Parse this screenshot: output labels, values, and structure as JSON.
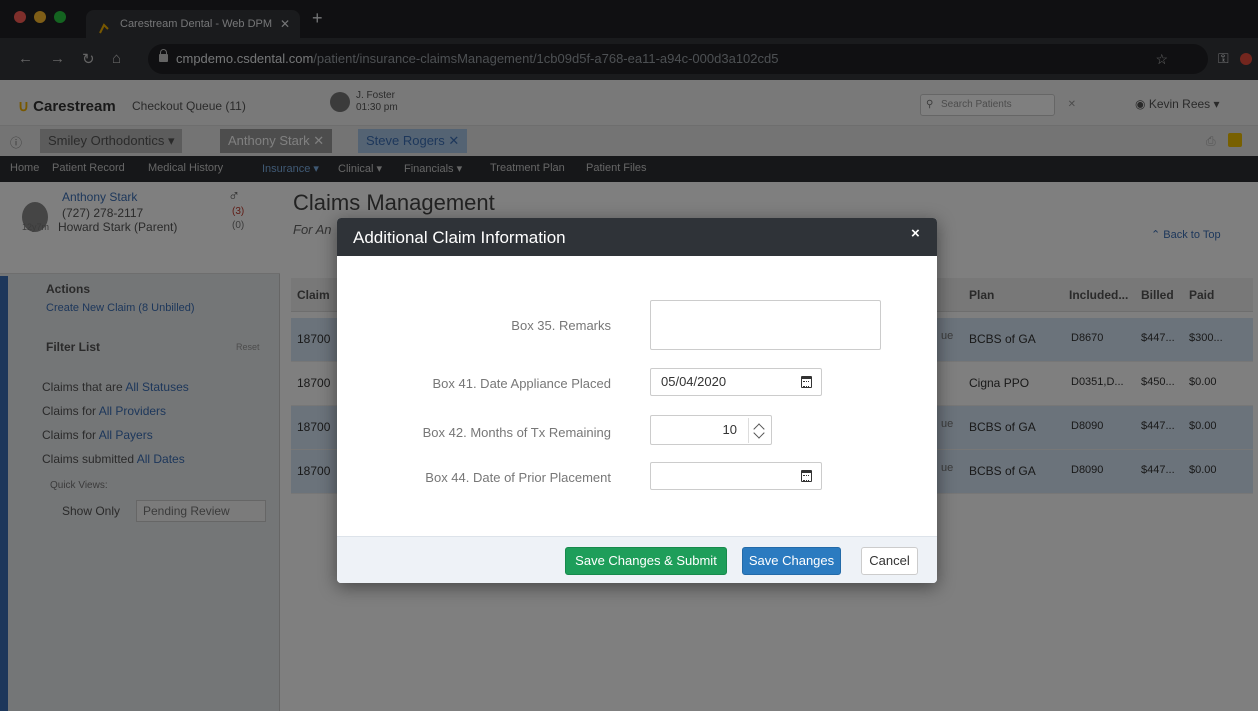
{
  "browser": {
    "tab_title": "Carestream Dental - Web DPM",
    "url_host": "cmpdemo.csdental.com",
    "url_path": "/patient/insurance-claimsManagement/1cb09d5f-a768-ea11-a94c-000d3a102cd5"
  },
  "app_header": {
    "logo": "Carestream",
    "checkout": "Checkout Queue (11)",
    "user_name": "J. Foster",
    "user_time": "01:30 pm",
    "search_placeholder": "Search Patients",
    "account": "Kevin Rees"
  },
  "patient_tabs": [
    "Smiley Orthodontics",
    "Anthony Stark",
    "Steve Rogers"
  ],
  "nav": [
    "Home",
    "Patient Record",
    "Medical History",
    "Insurance",
    "Clinical",
    "Financials",
    "Treatment Plan",
    "Patient Files"
  ],
  "patient": {
    "name": "Anthony Stark",
    "phone": "(727) 278-2117",
    "age": "12y7m",
    "guardian": "Howard Stark (Parent)",
    "count1": "(3)",
    "count2": "(0)"
  },
  "page": {
    "title": "Claims Management",
    "subtitle": "For An",
    "back": "Back to Top"
  },
  "sidebar": {
    "actions": "Actions",
    "create": "Create New Claim (8 Unbilled)",
    "filter": "Filter List",
    "reset": "Reset",
    "f1_label": "Claims that are",
    "f1_value": "All Statuses",
    "f2_label": "Claims for",
    "f2_value": "All Providers",
    "f3_label": "Claims for",
    "f3_value": "All Payers",
    "f4_label": "Claims submitted",
    "f4_value": "All Dates",
    "quick": "Quick Views:",
    "show_only": "Show Only",
    "pending": "Pending Review"
  },
  "grid": {
    "headers": {
      "claim": "Claim",
      "plan": "Plan",
      "included": "Included...",
      "billed": "Billed",
      "paid": "Paid"
    },
    "rows": [
      {
        "claim": "18700",
        "status": "ue",
        "plan": "BCBS of GA",
        "included": "D8670",
        "billed": "$447...",
        "paid": "$300..."
      },
      {
        "claim": "18700",
        "status": "",
        "plan": "Cigna PPO",
        "included": "D0351,D...",
        "billed": "$450...",
        "paid": "$0.00"
      },
      {
        "claim": "18700",
        "status": "ue",
        "plan": "BCBS of GA",
        "included": "D8090",
        "billed": "$447...",
        "paid": "$0.00"
      },
      {
        "claim": "18700",
        "status": "ue",
        "plan": "BCBS of GA",
        "included": "D8090",
        "billed": "$447...",
        "paid": "$0.00"
      }
    ]
  },
  "modal": {
    "title": "Additional Claim Information",
    "close": "×",
    "remarks_label": "Box 35. Remarks",
    "remarks_value": "",
    "appliance_label": "Box 41. Date Appliance Placed",
    "appliance_value": "05/04/2020",
    "months_label": "Box 42. Months of Tx Remaining",
    "months_value": "10",
    "prior_label": "Box 44. Date of Prior Placement",
    "prior_value": "",
    "btn_submit": "Save Changes & Submit",
    "btn_save": "Save Changes",
    "btn_cancel": "Cancel"
  },
  "colors": {
    "submit": "#1e9e5a",
    "save": "#2b7bc0",
    "modal_header": "#2f3338"
  }
}
